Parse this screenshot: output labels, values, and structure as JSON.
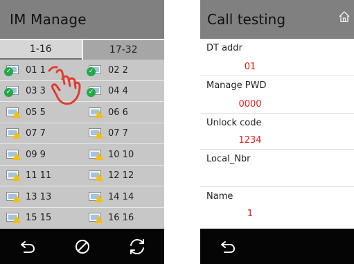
{
  "left": {
    "title": "IM Manage",
    "tabs": [
      "1-16",
      "17-32"
    ],
    "rows": [
      [
        {
          "label": "01 1",
          "status": "ok"
        },
        {
          "label": "02 2",
          "status": "ok"
        }
      ],
      [
        {
          "label": "03 3",
          "status": "ok"
        },
        {
          "label": "04 4",
          "status": "ok"
        }
      ],
      [
        {
          "label": "05 5",
          "status": "warn"
        },
        {
          "label": "06 6",
          "status": "warn"
        }
      ],
      [
        {
          "label": "07 7",
          "status": "warn"
        },
        {
          "label": "07 7",
          "status": "warn"
        }
      ],
      [
        {
          "label": "09 9",
          "status": "warn"
        },
        {
          "label": "10 10",
          "status": "warn"
        }
      ],
      [
        {
          "label": "11 11",
          "status": "warn"
        },
        {
          "label": "12 12",
          "status": "warn"
        }
      ],
      [
        {
          "label": "13 13",
          "status": "warn"
        },
        {
          "label": "14 14",
          "status": "warn"
        }
      ],
      [
        {
          "label": "15 15",
          "status": "warn"
        },
        {
          "label": "16 16",
          "status": "warn"
        }
      ]
    ],
    "footer_icons": [
      "back-icon",
      "cancel-icon",
      "refresh-icon"
    ]
  },
  "right": {
    "title": "Call testing",
    "fields": [
      {
        "label": "DT addr",
        "value": "01"
      },
      {
        "label": "Manage PWD",
        "value": "0000"
      },
      {
        "label": "Unlock code",
        "value": "1234"
      },
      {
        "label": "Local_Nbr",
        "value": ""
      },
      {
        "label": "Name",
        "value": "1"
      }
    ],
    "footer_icons": [
      "back-icon"
    ]
  },
  "colors": {
    "header_bg": "#808080",
    "footer_bg": "#050505",
    "value_red": "#e11d1d",
    "ok_green": "#25a848",
    "warn_yellow": "#f2c012",
    "hand_red": "#e23b2e"
  }
}
